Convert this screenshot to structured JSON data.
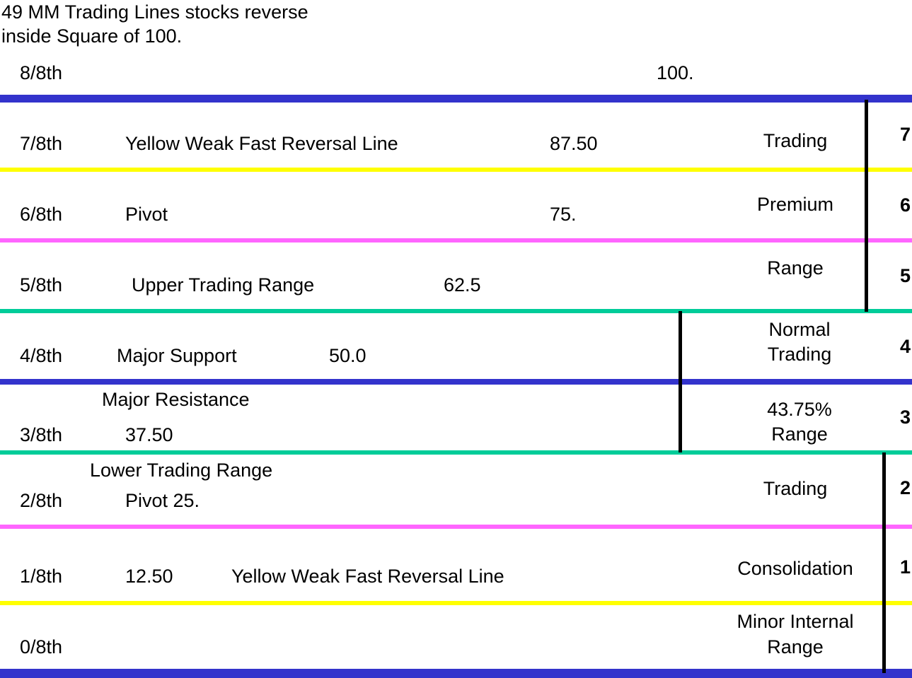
{
  "title": [
    "49 MM Trading Lines stocks reverse",
    "inside Square of 100."
  ],
  "colors": {
    "blue": "#3333cc",
    "yellow": "#ffff00",
    "magenta": "#ff66ff",
    "teal": "#00cc99",
    "black": "#000000"
  },
  "levels": [
    {
      "fraction": "8/8th",
      "label": "",
      "value": "100."
    },
    {
      "fraction": "7/8th",
      "label": "Yellow Weak Fast Reversal Line",
      "value": "87.50"
    },
    {
      "fraction": "6/8th",
      "label": "Pivot",
      "value": "75."
    },
    {
      "fraction": "5/8th",
      "label": "Upper Trading Range",
      "value": "62.5"
    },
    {
      "fraction": "4/8th",
      "label": "Major Support",
      "value": "50.0"
    },
    {
      "fraction": "3/8th",
      "label": "Major Resistance",
      "value": "37.50"
    },
    {
      "fraction": "2/8th",
      "label": "Lower Trading Range",
      "value": "Pivot 25."
    },
    {
      "fraction": "1/8th",
      "label": "Yellow Weak Fast Reversal Line",
      "value": "12.50"
    },
    {
      "fraction": "0/8th",
      "label": "",
      "value": ""
    }
  ],
  "ranges": [
    {
      "name": "Premium Trading Range",
      "lines": [
        "Trading",
        "Premium",
        "Range"
      ]
    },
    {
      "name": "Normal Trading Range",
      "lines": [
        "Normal",
        "Trading",
        "43.75%",
        "Range"
      ]
    },
    {
      "name": "Consolidation Range",
      "lines": [
        "Trading",
        "Consolidation",
        "Minor Internal",
        "Range"
      ]
    }
  ],
  "zone_numbers": [
    "7",
    "6",
    "5",
    "4",
    "3",
    "2",
    "1"
  ]
}
